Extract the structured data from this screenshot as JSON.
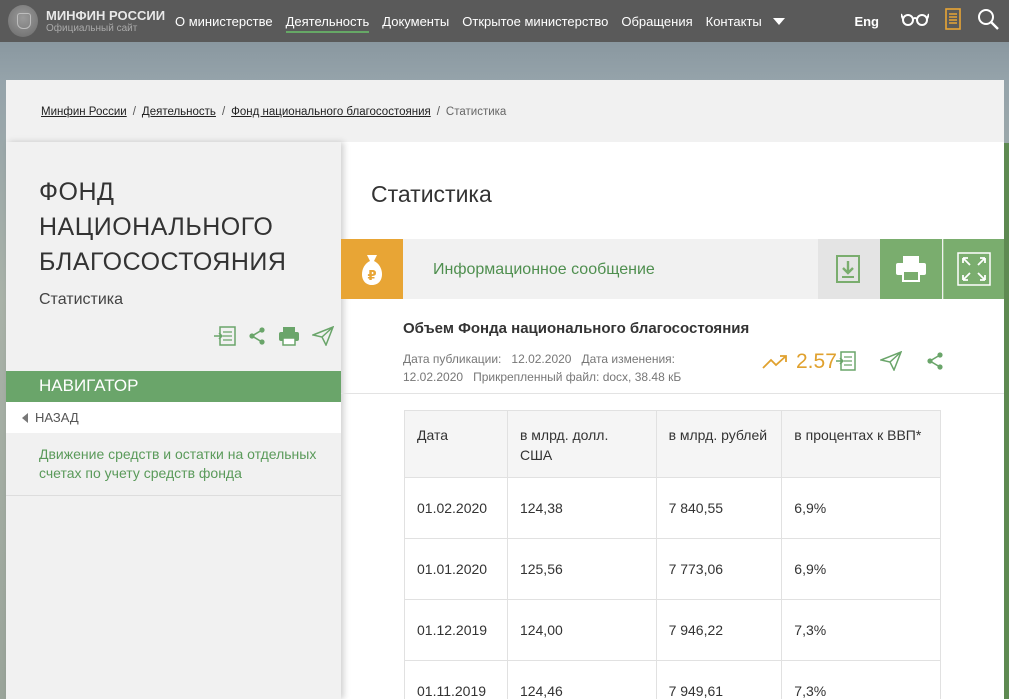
{
  "header": {
    "logo_title": "МИНФИН РОССИИ",
    "logo_subtitle": "Официальный сайт",
    "nav": [
      {
        "label": "О министерстве"
      },
      {
        "label": "Деятельность"
      },
      {
        "label": "Документы"
      },
      {
        "label": "Открытое министерство"
      },
      {
        "label": "Обращения"
      },
      {
        "label": "Контакты"
      }
    ],
    "lang_label": "Eng",
    "accent_color": "#66a866"
  },
  "breadcrumb": [
    {
      "label": "Минфин России"
    },
    {
      "label": "Деятельность"
    },
    {
      "label": "Фонд национального благосостояния"
    },
    {
      "label": "Статистика"
    }
  ],
  "sidebar": {
    "title": "ФОНД НАЦИОНАЛЬНОГО БЛАГОСОСТОЯНИЯ",
    "subtitle": "Статистика",
    "navigator_label": "НАВИГАТОР",
    "back_label": "НАЗАД",
    "links": [
      {
        "label": "Движение средств и остатки на отдельных счетах по учету средств фонда"
      }
    ]
  },
  "main": {
    "title": "Статистика",
    "info_label": "Информационное сообщение",
    "document": {
      "title": "Объем Фонда национального благосостояния",
      "pub_label": "Дата публикации:",
      "pub_date": "12.02.2020",
      "mod_label": "Дата изменения:",
      "mod_date": "12.02.2020",
      "file_label": "Прикрепленный файл:",
      "file_info": "docx, 38.48 кБ",
      "views": "2.57"
    }
  },
  "table": {
    "headers": [
      "Дата",
      "в млрд. долл. США",
      "в млрд. рублей",
      "в процентах к ВВП*"
    ],
    "rows": [
      [
        "01.02.2020",
        "124,38",
        "7 840,55",
        "6,9%"
      ],
      [
        "01.01.2020",
        "125,56",
        "7 773,06",
        "6,9%"
      ],
      [
        "01.12.2019",
        "124,00",
        "7 946,22",
        "7,3%"
      ],
      [
        "01.11.2019",
        "124,46",
        "7 949,61",
        "7,3%"
      ]
    ]
  },
  "colors": {
    "green": "#6aa56a",
    "orange": "#e8a535",
    "topbar": "#5a5a5a"
  }
}
